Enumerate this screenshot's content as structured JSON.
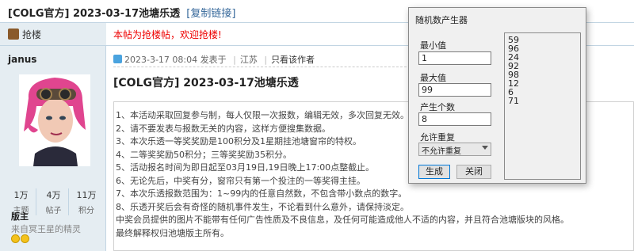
{
  "page": {
    "title": "[COLG官方] 2023-03-17池塘乐透",
    "copy_link": "[复制链接]"
  },
  "sofa": {
    "label": "抢楼",
    "notice": "本帖为抢楼帖，欢迎抢楼!"
  },
  "author": {
    "name": "janus",
    "stats": [
      {
        "value": "1万",
        "label": "主题"
      },
      {
        "value": "4万",
        "label": "帖子"
      },
      {
        "value": "11万",
        "label": "积分"
      }
    ],
    "role": "版主",
    "motto": "来自冥王星的精灵"
  },
  "post": {
    "date": "2023-3-17 08:04",
    "posted_at": "发表于",
    "location": "江苏",
    "only_author": "只看该作者",
    "title": "[COLG官方] 2023-03-17池塘乐透",
    "lines": [
      "1、本活动采取回复参与制，每人仅限一次报数，编辑无效，多次回复无效。",
      "2、请不要发表与报数无关的内容，这样方便搜集数据。",
      "3、本次乐透一等奖奖励是100积分及1星期挂池塘窗帘的特权。",
      "4、二等奖奖励50积分；三等奖奖励35积分。",
      "5、活动报名时间为即日起至03月19日,19日晚上17:00点整截止。",
      "6、无论先后，中奖有分，窗帘只有第一个投注的一等奖得主挂。",
      "7、本次乐透报数范围为：1~99内的任意自然数，不包含带小数点的数字。",
      "8、乐透开奖后会有奇怪的随机事件发生，不论看到什么意外，请保持淡定。",
      "中奖会员提供的图片不能带有任何广告性质及不良信息，及任何可能造成他人不适的内容，并且符合池塘版块的风格。",
      "最终解释权归池塘版主所有。"
    ]
  },
  "dialog": {
    "title": "随机数产生器",
    "min_label": "最小值",
    "min_value": "1",
    "max_label": "最大值",
    "max_value": "99",
    "count_label": "产生个数",
    "count_value": "8",
    "repeat_label": "允许重复",
    "repeat_value": "不允许重复",
    "generate_label": "生成",
    "close_label": "关闭",
    "results": [
      "59",
      "96",
      "24",
      "92",
      "98",
      "12",
      "6",
      "71"
    ]
  }
}
